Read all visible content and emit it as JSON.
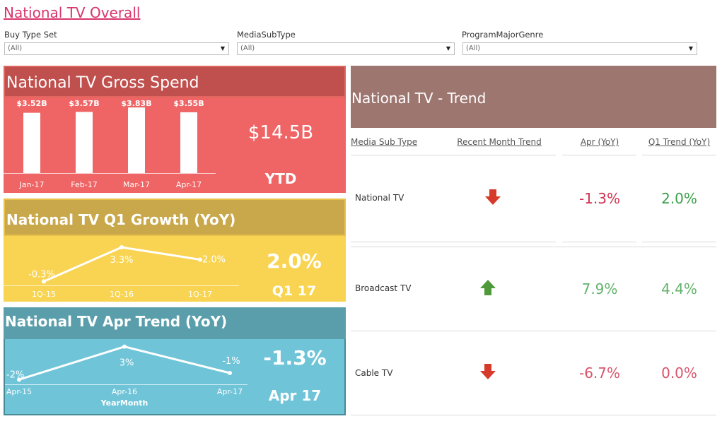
{
  "page_title": "National TV Overall",
  "filters": [
    {
      "label": "Buy Type Set",
      "value": "(All)"
    },
    {
      "label": "MediaSubType",
      "value": "(All)"
    },
    {
      "label": "ProgramMajorGenre",
      "value": "(All)"
    }
  ],
  "gross_spend": {
    "title": "National TV Gross Spend",
    "total": "$14.5B",
    "total_label": "YTD",
    "colors": {
      "header": "#c0504d",
      "body": "#ef6464"
    }
  },
  "q1_growth": {
    "title": "National TV Q1 Growth (YoY)",
    "value": "2.0%",
    "value_label": "Q1 17",
    "colors": {
      "header": "#c8a84a",
      "body": "#f8d452"
    }
  },
  "apr_trend": {
    "title": "National TV Apr Trend (YoY)",
    "value": "-1.3%",
    "value_label": "Apr 17",
    "xlabel": "YearMonth",
    "colors": {
      "header": "#5a9eab",
      "body": "#6fc4d8"
    }
  },
  "chart_data": [
    {
      "type": "bar",
      "categories": [
        "Jan-17",
        "Feb-17",
        "Mar-17",
        "Apr-17"
      ],
      "values": [
        3.52,
        3.57,
        3.83,
        3.55
      ],
      "labels": [
        "$3.52B",
        "$3.57B",
        "$3.83B",
        "$3.55B"
      ],
      "ylim": [
        0,
        4
      ]
    },
    {
      "type": "line",
      "categories": [
        "1Q-15",
        "1Q-16",
        "1Q-17"
      ],
      "values": [
        -0.3,
        3.3,
        2.0
      ],
      "labels": [
        "-0.3%",
        "3.3%",
        "2.0%"
      ],
      "ylim": [
        -0.5,
        3.6
      ]
    },
    {
      "type": "line",
      "categories": [
        "Apr-15",
        "Apr-16",
        "Apr-17"
      ],
      "values": [
        -2,
        3,
        -1
      ],
      "labels": [
        "-2%",
        "3%",
        "-1%"
      ],
      "xlabel": "YearMonth",
      "ylim": [
        -2.5,
        3.5
      ]
    }
  ],
  "trend": {
    "title": "National TV - Trend",
    "header_color": "#9e7670",
    "columns": [
      "Media Sub Type",
      "Recent Month Trend",
      "Apr (YoY)",
      "Q1 Trend (YoY)"
    ],
    "rows": [
      {
        "name": "National TV",
        "direction": "down",
        "apr": "-1.3%",
        "q1": "2.0%",
        "apr_color": "#d0314f",
        "q1_color": "#3aa14a"
      },
      {
        "name": "Broadcast TV",
        "direction": "up",
        "apr": "7.9%",
        "q1": "4.4%",
        "apr_color": "#62b36b",
        "q1_color": "#62b36b"
      },
      {
        "name": "Cable TV",
        "direction": "down",
        "apr": "-6.7%",
        "q1": "0.0%",
        "apr_color": "#d9546b",
        "q1_color": "#d9546b"
      }
    ],
    "arrow_colors": {
      "down": "#d63a2b",
      "up": "#4e9a3a"
    }
  }
}
